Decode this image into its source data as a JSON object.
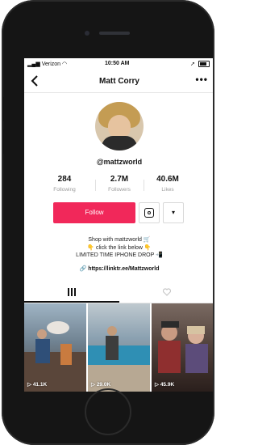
{
  "status_bar": {
    "carrier": "Verizon",
    "time": "10:50 AM"
  },
  "nav": {
    "back_icon": "chevron-left-icon",
    "title": "Matt Corry",
    "more_label": "•••"
  },
  "profile": {
    "username": "@mattzworld"
  },
  "stats": [
    {
      "value": "284",
      "label": "Following"
    },
    {
      "value": "2.7M",
      "label": "Followers"
    },
    {
      "value": "40.6M",
      "label": "Likes"
    }
  ],
  "actions": {
    "follow_label": "Follow",
    "follow_color": "#f1285a",
    "more_options_icon": "▾"
  },
  "bio": {
    "line1": "Shop with mattzworld 🛒",
    "line2": "👇 click the link below 👇",
    "line3": "LIMITED TIME IPHONE DROP 📲",
    "link": "https://linktr.ee/Mattzworld"
  },
  "tabs": [
    {
      "name": "videos",
      "icon": "grid-icon",
      "active": true
    },
    {
      "name": "liked",
      "icon": "heart-icon",
      "active": false
    }
  ],
  "videos": [
    {
      "views": "41.1K"
    },
    {
      "views": "29.0K"
    },
    {
      "views": "45.9K"
    }
  ]
}
